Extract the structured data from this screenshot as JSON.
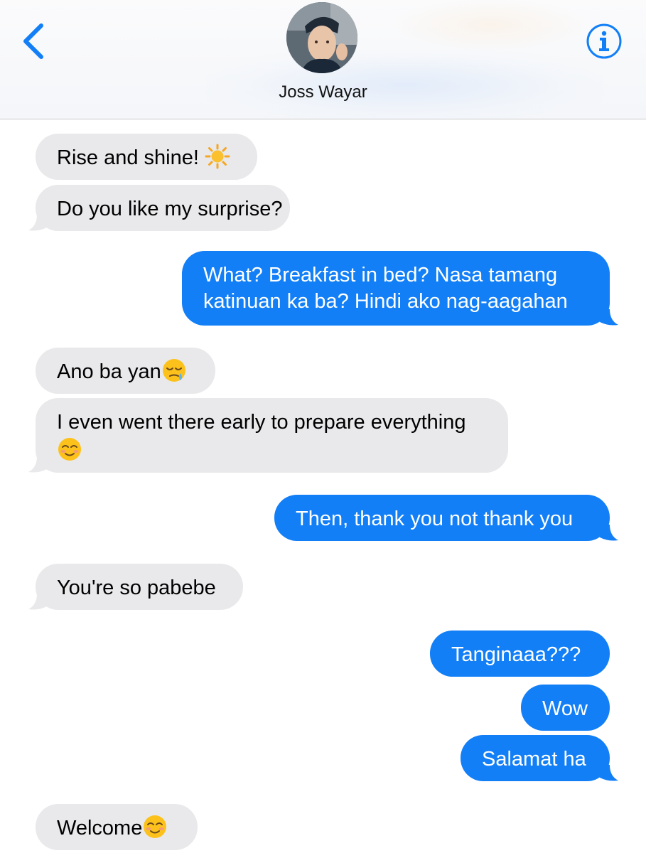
{
  "header": {
    "contact_name": "Joss Wayar",
    "back_icon": "chevron-left-icon",
    "info_icon": "info-icon",
    "accent_color": "#127ff7"
  },
  "messages": [
    {
      "side": "in",
      "text": "Rise and shine! ",
      "emoji": "sun-emoji"
    },
    {
      "side": "in",
      "text": "Do you like my surprise?"
    },
    {
      "side": "out",
      "line1": "What? Breakfast in bed? Nasa tamang",
      "line2": "katinuan ka ba? Hindi ako nag-aagahan"
    },
    {
      "side": "in",
      "text": "Ano ba yan",
      "emoji": "sleepy-face-emoji"
    },
    {
      "side": "in",
      "line1": "I even went there early to prepare everything",
      "emoji": "smiling-face-emoji"
    },
    {
      "side": "out",
      "text": "Then, thank you not thank you"
    },
    {
      "side": "in",
      "text": "You're so pabebe"
    },
    {
      "side": "out",
      "text": "Tanginaaa???"
    },
    {
      "side": "out",
      "text": "Wow"
    },
    {
      "side": "out",
      "text": "Salamat ha"
    },
    {
      "side": "in",
      "text": "Welcome",
      "emoji": "smiling-face-emoji"
    }
  ],
  "colors": {
    "incoming_bubble": "#e9e9eb",
    "outgoing_bubble": "#127ff7"
  }
}
